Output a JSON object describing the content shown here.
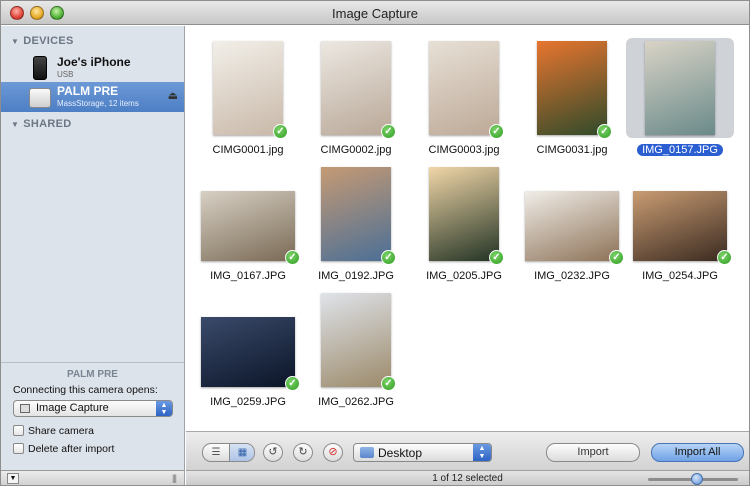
{
  "window": {
    "title": "Image Capture"
  },
  "sidebar": {
    "devices_header": "DEVICES",
    "shared_header": "SHARED",
    "devices": [
      {
        "name": "Joe's iPhone",
        "sub": "USB"
      },
      {
        "name": "PALM PRE",
        "sub": "MassStorage, 12 items",
        "selected": true
      }
    ],
    "panel": {
      "title": "PALM PRE",
      "open_label": "Connecting this camera opens:",
      "open_app": "Image Capture",
      "share_camera": "Share camera",
      "delete_after_import": "Delete after import"
    }
  },
  "photos": [
    {
      "label": "CIMG0001.jpg",
      "colors": [
        "#c9b9a9",
        "#f2efe9"
      ],
      "checked": true
    },
    {
      "label": "CIMG0002.jpg",
      "colors": [
        "#b9a898",
        "#ece8e2"
      ],
      "checked": true
    },
    {
      "label": "CIMG0003.jpg",
      "colors": [
        "#bda997",
        "#e7e0d6"
      ],
      "checked": true
    },
    {
      "label": "CIMG0031.jpg",
      "colors": [
        "#2f4a2a",
        "#e8752f"
      ],
      "checked": true
    },
    {
      "label": "IMG_0157.JPG",
      "colors": [
        "#6a8a8a",
        "#d9d3c6"
      ],
      "checked": false,
      "selected": true
    },
    {
      "label": "IMG_0167.JPG",
      "colors": [
        "#7a6a55",
        "#d7d0c4"
      ],
      "checked": true
    },
    {
      "label": "IMG_0192.JPG",
      "colors": [
        "#4b6f96",
        "#c59a74"
      ],
      "checked": true
    },
    {
      "label": "IMG_0205.JPG",
      "colors": [
        "#223324",
        "#f1d6a8"
      ],
      "checked": true
    },
    {
      "label": "IMG_0232.JPG",
      "colors": [
        "#8d7257",
        "#f0ede8"
      ],
      "checked": true
    },
    {
      "label": "IMG_0254.JPG",
      "colors": [
        "#3a2a20",
        "#c99c73"
      ],
      "checked": true
    },
    {
      "label": "IMG_0259.JPG",
      "colors": [
        "#0b1528",
        "#3a4a6a"
      ],
      "checked": true
    },
    {
      "label": "IMG_0262.JPG",
      "colors": [
        "#9c8a6a",
        "#dfe3ea"
      ],
      "checked": true
    }
  ],
  "toolbar": {
    "destination": "Desktop",
    "import_label": "Import",
    "import_all_label": "Import All"
  },
  "status": {
    "text": "1 of 12 selected",
    "zoom_level": 0.55
  },
  "icons": {
    "list_view": "list-view-icon",
    "icon_view": "icon-view-icon",
    "rotate_left": "rotate-left-icon",
    "rotate_right": "rotate-right-icon",
    "delete": "delete-icon",
    "eject": "eject-icon",
    "check": "check-icon"
  }
}
